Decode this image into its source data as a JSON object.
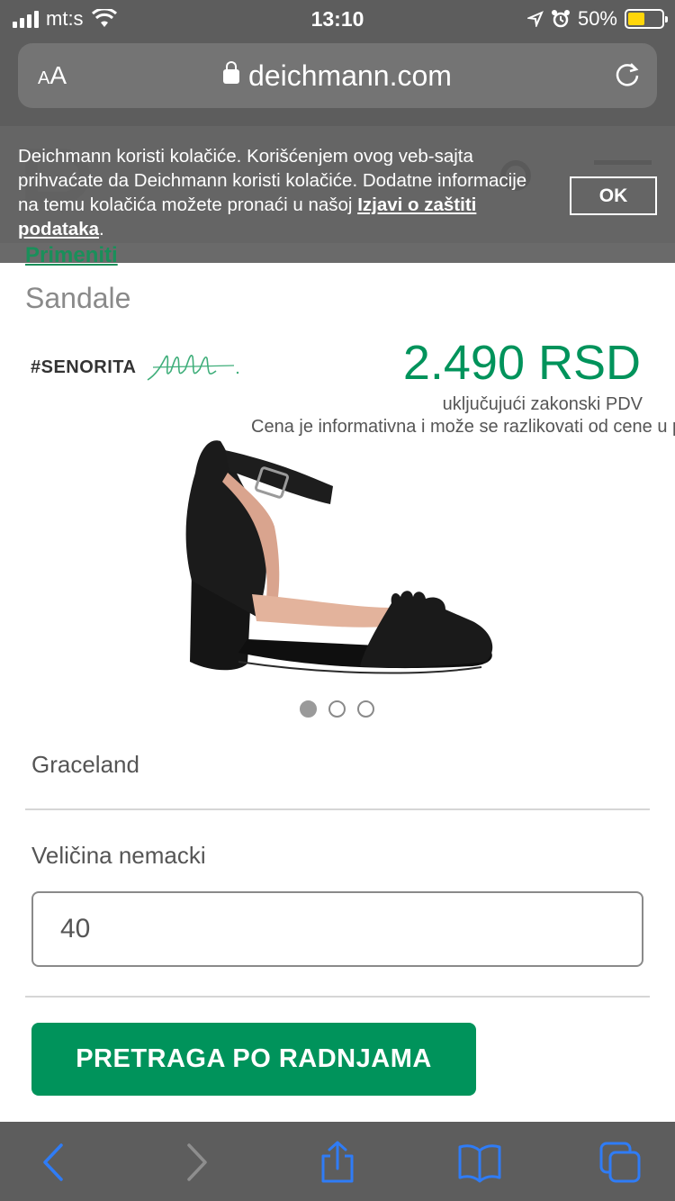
{
  "status_bar": {
    "carrier": "mt:s",
    "time": "13:10",
    "battery_percent": "50%"
  },
  "url_bar": {
    "text_size_label": "AA",
    "domain": "deichmann.com"
  },
  "cookie_banner": {
    "text": "Deichmann koristi kolačiće. Korišćenjem ovog veb-sajta prihvaćate da Deichmann koristi kolačiće. Dodatne informacije na temu kolačića možete pronaći u našoj ",
    "link_text": "Izjavi o zaštiti podataka",
    "suffix": ".",
    "ok_label": "OK"
  },
  "page": {
    "apply_link": "Primeniti",
    "category": "Sandale",
    "brand_tag": "#SENORITA",
    "price": "2.490 RSD",
    "vat_note": "uključujući zakonski PDV",
    "disclaimer": "Cena je informativna i može se razlikovati od cene u prodavnici",
    "carousel": {
      "count": 3,
      "active": 1
    },
    "brand_name": "Graceland",
    "size_label": "Veličina nemacki",
    "size_value": "40",
    "store_button": "PRETRAGA PO RADNJAMA"
  },
  "colors": {
    "accent_green": "#00935b",
    "chrome_gray": "#5d5d5d",
    "ios_blue": "#2f7cf6"
  },
  "toolbar": {
    "icons": [
      "back-icon",
      "forward-icon",
      "share-icon",
      "bookmarks-icon",
      "tabs-icon"
    ]
  }
}
